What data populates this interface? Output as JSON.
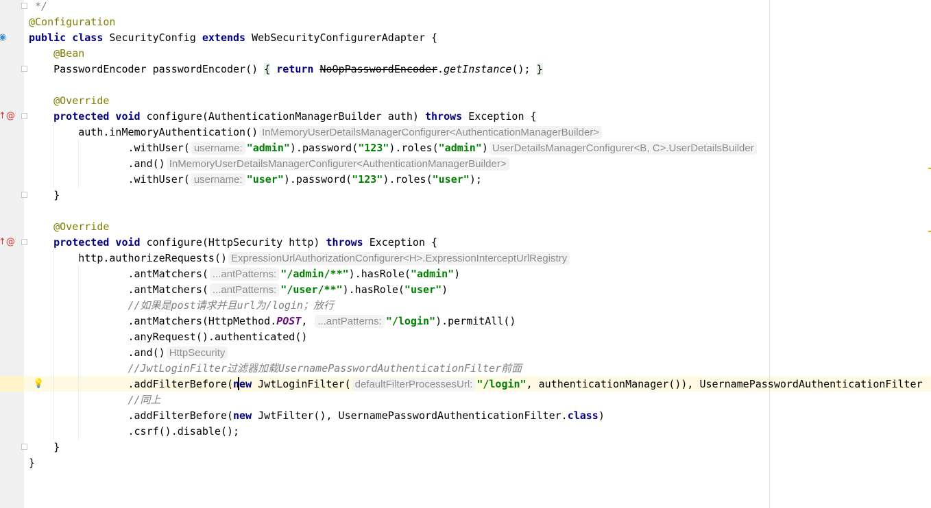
{
  "editor": {
    "current_line_index": 24,
    "lines": [
      [
        {
          "t": " */",
          "c": "cmt"
        }
      ],
      [
        {
          "t": "@Configuration",
          "c": "ann"
        }
      ],
      [
        {
          "t": "public class",
          "c": "kw"
        },
        {
          "t": " SecurityConfig "
        },
        {
          "t": "extends",
          "c": "kw"
        },
        {
          "t": " WebSecurityConfigurerAdapter {"
        }
      ],
      [
        {
          "t": "    "
        },
        {
          "t": "@Bean",
          "c": "ann"
        }
      ],
      [
        {
          "t": "    PasswordEncoder passwordEncoder() "
        },
        {
          "t": "{",
          "c": "brace"
        },
        {
          "t": " "
        },
        {
          "t": "return",
          "c": "kw"
        },
        {
          "t": " "
        },
        {
          "t": "NoOpPasswordEncoder",
          "c": "strike"
        },
        {
          "t": "."
        },
        {
          "t": "getInstance",
          "c": "ital"
        },
        {
          "t": "(); "
        },
        {
          "t": "}",
          "c": "brace"
        }
      ],
      [],
      [
        {
          "t": "    "
        },
        {
          "t": "@Override",
          "c": "ann"
        }
      ],
      [
        {
          "t": "    "
        },
        {
          "t": "protected void",
          "c": "kw"
        },
        {
          "t": " configure(AuthenticationManagerBuilder auth) "
        },
        {
          "t": "throws",
          "c": "kw"
        },
        {
          "t": " Exception {"
        }
      ],
      [
        {
          "t": "        auth.inMemoryAuthentication()"
        },
        {
          "t": "InMemoryUserDetailsManagerConfigurer<AuthenticationManagerBuilder>",
          "c": "hint"
        }
      ],
      [
        {
          "t": "                .withUser("
        },
        {
          "t": "username:",
          "c": "hint"
        },
        {
          "t": "\"admin\"",
          "c": "str"
        },
        {
          "t": ").password("
        },
        {
          "t": "\"123\"",
          "c": "str"
        },
        {
          "t": ").roles("
        },
        {
          "t": "\"admin\"",
          "c": "str"
        },
        {
          "t": ")"
        },
        {
          "t": "UserDetailsManagerConfigurer<B, C>.UserDetailsBuilder",
          "c": "hint"
        }
      ],
      [
        {
          "t": "                .and()"
        },
        {
          "t": "InMemoryUserDetailsManagerConfigurer<AuthenticationManagerBuilder>",
          "c": "hint"
        }
      ],
      [
        {
          "t": "                .withUser("
        },
        {
          "t": "username:",
          "c": "hint"
        },
        {
          "t": "\"user\"",
          "c": "str"
        },
        {
          "t": ").password("
        },
        {
          "t": "\"123\"",
          "c": "str"
        },
        {
          "t": ").roles("
        },
        {
          "t": "\"user\"",
          "c": "str"
        },
        {
          "t": ");"
        }
      ],
      [
        {
          "t": "    }"
        }
      ],
      [],
      [
        {
          "t": "    "
        },
        {
          "t": "@Override",
          "c": "ann"
        }
      ],
      [
        {
          "t": "    "
        },
        {
          "t": "protected void",
          "c": "kw"
        },
        {
          "t": " configure(HttpSecurity http) "
        },
        {
          "t": "throws",
          "c": "kw"
        },
        {
          "t": " Exception {"
        }
      ],
      [
        {
          "t": "        http.authorizeRequests()"
        },
        {
          "t": "ExpressionUrlAuthorizationConfigurer<H>.ExpressionInterceptUrlRegistry",
          "c": "hint"
        }
      ],
      [
        {
          "t": "                .antMatchers("
        },
        {
          "t": "...antPatterns:",
          "c": "hint"
        },
        {
          "t": "\"/admin/**\"",
          "c": "str"
        },
        {
          "t": ").hasRole("
        },
        {
          "t": "\"admin\"",
          "c": "str"
        },
        {
          "t": ")"
        }
      ],
      [
        {
          "t": "                .antMatchers("
        },
        {
          "t": "...antPatterns:",
          "c": "hint"
        },
        {
          "t": "\"/user/**\"",
          "c": "str"
        },
        {
          "t": ").hasRole("
        },
        {
          "t": "\"user\"",
          "c": "str"
        },
        {
          "t": ")"
        }
      ],
      [
        {
          "t": "                "
        },
        {
          "t": "//如果是post请求并且url为/login；放行",
          "c": "cmt"
        }
      ],
      [
        {
          "t": "                .antMatchers(HttpMethod."
        },
        {
          "t": "POST",
          "c": "const"
        },
        {
          "t": ", "
        },
        {
          "t": "...antPatterns:",
          "c": "hint"
        },
        {
          "t": "\"/login\"",
          "c": "str"
        },
        {
          "t": ").permitAll()"
        }
      ],
      [
        {
          "t": "                .anyRequest().authenticated()"
        }
      ],
      [
        {
          "t": "                .and()"
        },
        {
          "t": "HttpSecurity",
          "c": "hint"
        }
      ],
      [
        {
          "t": "                "
        },
        {
          "t": "//JwtLoginFilter过滤器加载UsernamePasswordAuthenticationFilter前面",
          "c": "cmt"
        }
      ],
      [
        {
          "t": "                .addFilterBefore("
        },
        {
          "t": "new",
          "c": "kw"
        },
        {
          "t": " JwtLoginFilter("
        },
        {
          "t": "defaultFilterProcessesUrl:",
          "c": "hint"
        },
        {
          "t": "\"/login\"",
          "c": "str"
        },
        {
          "t": ", authenticationManager()), UsernamePasswordAuthenticationFilter"
        }
      ],
      [
        {
          "t": "                "
        },
        {
          "t": "//同上",
          "c": "cmt"
        }
      ],
      [
        {
          "t": "                .addFilterBefore("
        },
        {
          "t": "new",
          "c": "kw"
        },
        {
          "t": " JwtFilter(), UsernamePasswordAuthenticationFilter."
        },
        {
          "t": "class",
          "c": "kw"
        },
        {
          "t": ")"
        }
      ],
      [
        {
          "t": "                .csrf().disable();"
        }
      ],
      [
        {
          "t": "    }"
        }
      ],
      [
        {
          "t": "}"
        }
      ]
    ]
  },
  "gutter": {
    "icons": [
      {
        "line": 2,
        "name": "overrides-icon",
        "glyph": "◉",
        "color": "#3d8fd1"
      },
      {
        "line": 7,
        "name": "override-method-icon",
        "glyph": "↑@",
        "color": "#d33"
      },
      {
        "line": 15,
        "name": "override-method-icon",
        "glyph": "↑@",
        "color": "#d33"
      },
      {
        "line": 24,
        "name": "lightbulb-icon",
        "glyph": "💡",
        "color": "#f0a30a"
      }
    ],
    "folds": [
      0,
      4,
      7,
      12,
      15,
      28
    ]
  }
}
